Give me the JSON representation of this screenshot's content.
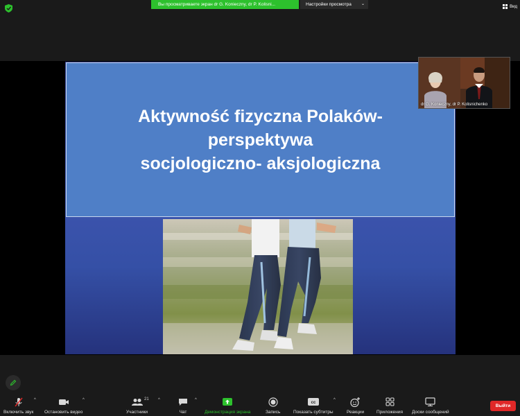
{
  "top_bar": {
    "share_banner": "Вы просматриваете экран dr G. Konieczny, dr P. Kolisni...",
    "view_options": "Настройки просмотра",
    "view_right": "Вид"
  },
  "slide": {
    "title_line1": "Aktywność fizyczna Polaków-",
    "title_line2": "perspektywa",
    "title_line3": "socjologiczno- aksjologiczna"
  },
  "thumbnail": {
    "label": "dr G. Konieczny, dr P. Kolisnichenko"
  },
  "toolbar": {
    "mute_label": "Включить звук",
    "video_label": "Остановить видео",
    "participants_label": "Участники",
    "participants_count": "21",
    "chat_label": "Чат",
    "share_label": "Демонстрация экрана",
    "record_label": "Запись",
    "subtitles_label": "Показать субтитры",
    "reactions_label": "Реакции",
    "apps_label": "Приложения",
    "whiteboards_label": "Доски сообщений",
    "leave_label": "Выйти"
  },
  "colors": {
    "accent_green": "#2dc12d",
    "leave_red": "#e02828",
    "slide_title_bg": "#4f7fc7",
    "slide_bg": "#3550a6"
  }
}
